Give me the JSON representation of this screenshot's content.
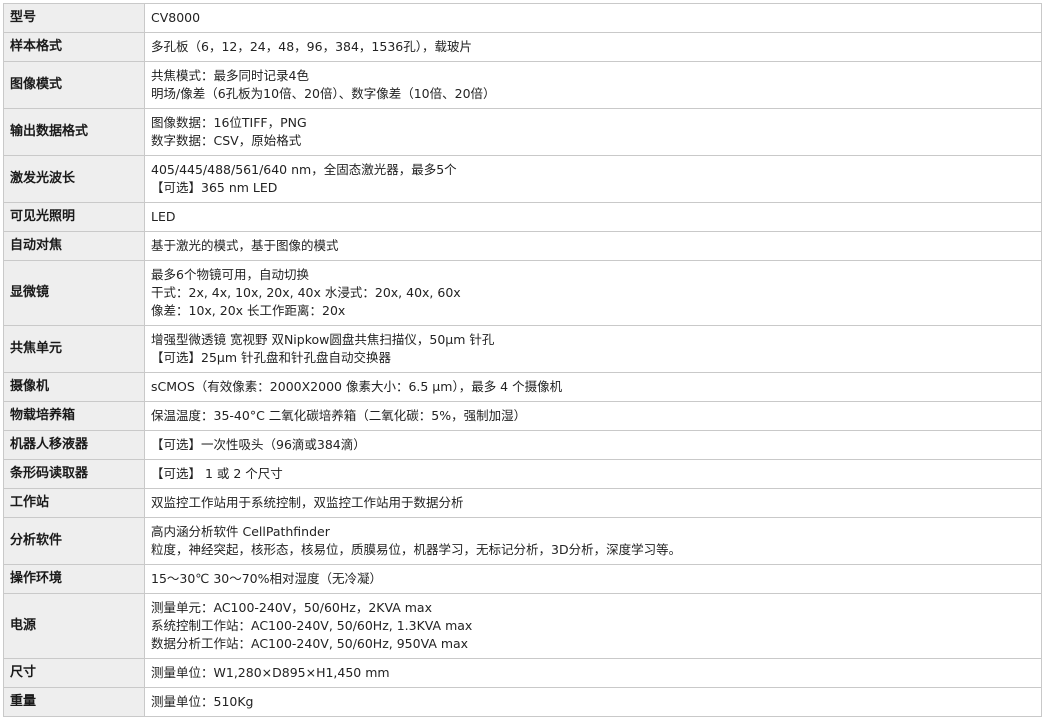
{
  "rows": [
    {
      "label": "型号",
      "lines": [
        "CV8000"
      ]
    },
    {
      "label": "样本格式",
      "lines": [
        "多孔板（6，12，24，48，96，384，1536孔），载玻片"
      ]
    },
    {
      "label": "图像模式",
      "lines": [
        "共焦模式：最多同时记录4色",
        "明场/像差（6孔板为10倍、20倍）、数字像差（10倍、20倍）"
      ]
    },
    {
      "label": "输出数据格式",
      "lines": [
        "图像数据：16位TIFF，PNG",
        "数字数据：CSV，原始格式"
      ]
    },
    {
      "label": "激发光波长",
      "lines": [
        "405/445/488/561/640 nm，全固态激光器，最多5个",
        "【可选】365 nm LED"
      ]
    },
    {
      "label": "可见光照明",
      "lines": [
        "LED"
      ]
    },
    {
      "label": "自动对焦",
      "lines": [
        "基于激光的模式，基于图像的模式"
      ]
    },
    {
      "label": "显微镜",
      "lines": [
        "最多6个物镜可用，自动切换",
        "干式：2x, 4x, 10x, 20x, 40x 水浸式：20x, 40x, 60x",
        "像差：10x, 20x 长工作距离：20x"
      ]
    },
    {
      "label": "共焦单元",
      "lines": [
        "增强型微透镜 宽视野 双Nipkow圆盘共焦扫描仪，50μm 针孔",
        "【可选】25μm 针孔盘和针孔盘自动交换器"
      ]
    },
    {
      "label": "摄像机",
      "lines": [
        "sCMOS（有效像素：2000X2000 像素大小：6.5 μm），最多 4 个摄像机"
      ]
    },
    {
      "label": "物载培养箱",
      "lines": [
        "保温温度：35-40°C 二氧化碳培养箱（二氧化碳：5%，强制加湿）"
      ]
    },
    {
      "label": "机器人移液器",
      "lines": [
        "【可选】一次性吸头（96滴或384滴）"
      ]
    },
    {
      "label": "条形码读取器",
      "lines": [
        "【可选】 1 或 2 个尺寸"
      ]
    },
    {
      "label": "工作站",
      "lines": [
        "双监控工作站用于系统控制，双监控工作站用于数据分析"
      ]
    },
    {
      "label": "分析软件",
      "lines": [
        "高内涵分析软件 CellPathfinder",
        "粒度，神经突起，核形态，核易位，质膜易位，机器学习，无标记分析，3D分析，深度学习等。"
      ]
    },
    {
      "label": "操作环境",
      "lines": [
        "15～30℃ 30～70%相对湿度（无冷凝）"
      ]
    },
    {
      "label": "电源",
      "lines": [
        "测量单元：AC100-240V，50/60Hz，2KVA max",
        "系统控制工作站：AC100-240V, 50/60Hz, 1.3KVA max",
        "数据分析工作站：AC100-240V, 50/60Hz, 950VA max"
      ]
    },
    {
      "label": "尺寸",
      "lines": [
        "测量单位：W1,280×D895×H1,450 mm"
      ]
    },
    {
      "label": "重量",
      "lines": [
        "测量单位：510Kg"
      ]
    }
  ]
}
